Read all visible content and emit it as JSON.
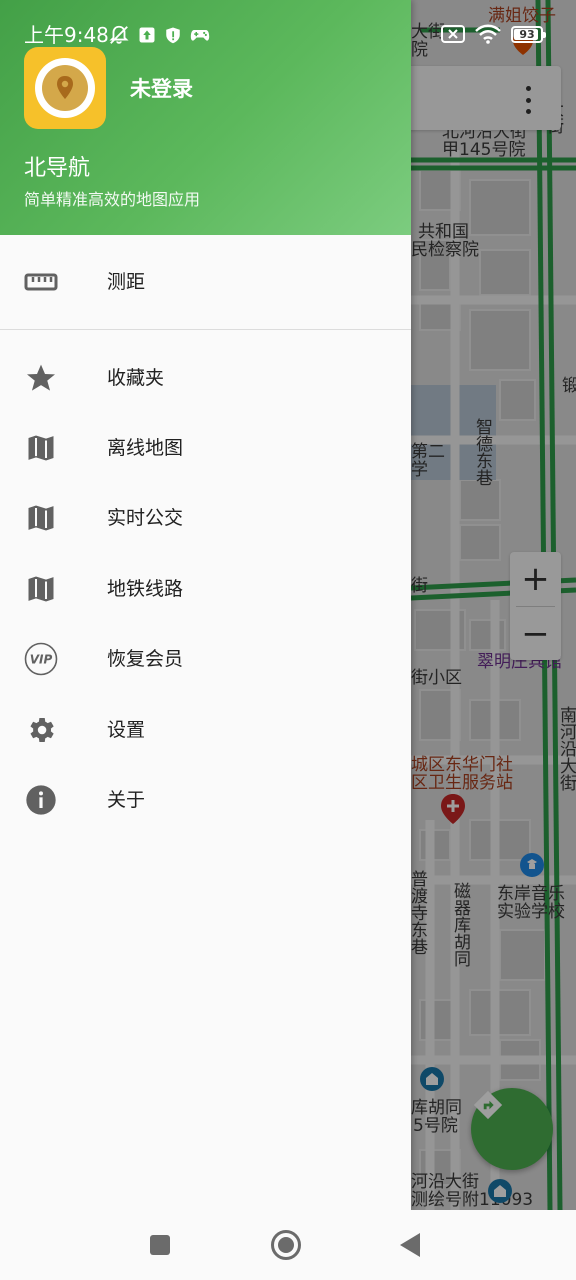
{
  "status_bar": {
    "time": "上午9:48",
    "battery": "93",
    "battery_level": 0.93
  },
  "drawer": {
    "login_text": "未登录",
    "app_name": "北导航",
    "app_desc": "简单精准高效的地图应用",
    "measure": {
      "label": "测距",
      "icon": "ruler-icon"
    },
    "items": [
      {
        "label": "收藏夹",
        "icon": "star-icon"
      },
      {
        "label": "离线地图",
        "icon": "map-icon"
      },
      {
        "label": "实时公交",
        "icon": "map-icon"
      },
      {
        "label": "地铁线路",
        "icon": "map-icon"
      },
      {
        "label": "恢复会员",
        "icon": "vip-icon"
      },
      {
        "label": "设置",
        "icon": "gear-icon"
      },
      {
        "label": "关于",
        "icon": "info-icon"
      }
    ]
  },
  "map": {
    "labels": {
      "l1": "大街",
      "l2": "院",
      "l3": "满姐饺子",
      "l4": "北河沿大街",
      "l5": "甲145号院",
      "l6": "大街",
      "l7": "共和国",
      "l8": "民检察院",
      "l9": "智德东巷",
      "l10": "第二",
      "l11": "学",
      "l12": "翠明庄宾馆",
      "l13": "街小区",
      "l14": "南河沿大街",
      "l15": "城区东华门社",
      "l16": "区卫生服务站",
      "l17": "东岸音乐",
      "l18": "实验学校",
      "l19": "普渡寺东巷",
      "l20": "磁器库胡同",
      "l21": "库胡同",
      "l22": "5号院",
      "l23": "河沿大街",
      "l24": "测绘号附11093",
      "l25": "街",
      "l26": "锻"
    },
    "zoom_in": "+",
    "zoom_out": "−",
    "colors": {
      "road": "#2e9b4a",
      "accent": "#4caf50",
      "pin": "#c62828",
      "school": "#1e88e5"
    }
  }
}
